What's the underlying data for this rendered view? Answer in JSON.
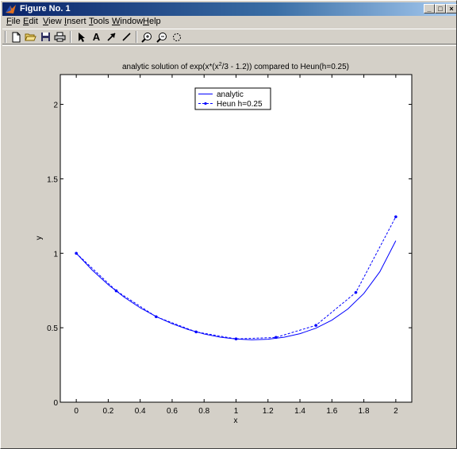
{
  "window": {
    "title": "Figure No. 1",
    "min_glyph": "_",
    "max_glyph": "□",
    "close_glyph": "×"
  },
  "menu": [
    "File",
    "Edit",
    "View",
    "Insert",
    "Tools",
    "Window",
    "Help"
  ],
  "toolbar": {
    "icons": [
      "new-file-icon",
      "open-folder-icon",
      "save-icon",
      "print-icon",
      "select-arrow-icon",
      "text-insert-icon",
      "arrow-insert-icon",
      "line-insert-icon",
      "zoom-in-icon",
      "zoom-out-icon",
      "rotate-icon"
    ],
    "text_tool_glyph": "A"
  },
  "colors": {
    "accent": "#0000ff",
    "plot_bg": "#ffffff",
    "figure_bg": "#d4d0c8"
  },
  "chart_data": {
    "type": "line",
    "title": {
      "prefix": "analytic solution of exp(x*(x",
      "superscript": "2",
      "suffix": "/3 - 1.2)) compared to Heun(h=0.25)"
    },
    "xlabel": "x",
    "ylabel": "y",
    "xlim": [
      -0.1,
      2.1
    ],
    "ylim": [
      0,
      2.2
    ],
    "xticks": [
      "0",
      "0.2",
      "0.4",
      "0.6",
      "0.8",
      "1",
      "1.2",
      "1.4",
      "1.6",
      "1.8",
      "2"
    ],
    "xtick_values": [
      0,
      0.2,
      0.4,
      0.6,
      0.8,
      1.0,
      1.2,
      1.4,
      1.6,
      1.8,
      2.0
    ],
    "yticks": [
      "0",
      "0.5",
      "1",
      "1.5",
      "2"
    ],
    "ytick_values": [
      0,
      0.5,
      1.0,
      1.5,
      2.0
    ],
    "grid": false,
    "legend_position": "top-center",
    "series": [
      {
        "name": "analytic",
        "style": "solid",
        "color": "#0000ff",
        "x": [
          0,
          0.1,
          0.2,
          0.3,
          0.4,
          0.5,
          0.6,
          0.7,
          0.8,
          0.9,
          1.0,
          1.1,
          1.2,
          1.3,
          1.4,
          1.5,
          1.6,
          1.7,
          1.8,
          1.9,
          2.0
        ],
        "y": [
          1.0,
          0.887,
          0.789,
          0.705,
          0.634,
          0.575,
          0.527,
          0.488,
          0.458,
          0.437,
          0.424,
          0.419,
          0.423,
          0.436,
          0.46,
          0.497,
          0.551,
          0.626,
          0.73,
          0.876,
          1.084
        ]
      },
      {
        "name": "Heun h=0.25",
        "style": "dashed",
        "marker": "dot",
        "color": "#0000ff",
        "x": [
          0,
          0.25,
          0.5,
          0.75,
          1.0,
          1.25,
          1.5,
          1.75,
          2.0
        ],
        "y": [
          1.0,
          0.748,
          0.574,
          0.472,
          0.425,
          0.435,
          0.516,
          0.737,
          1.245
        ]
      }
    ]
  }
}
